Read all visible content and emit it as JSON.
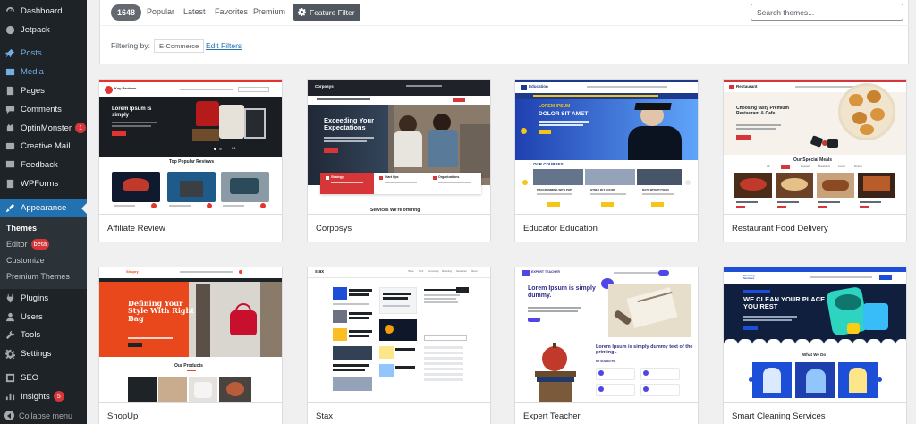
{
  "sidebar": {
    "items": [
      {
        "label": "Dashboard",
        "icon": "dashboard-icon"
      },
      {
        "label": "Jetpack",
        "icon": "jetpack-icon"
      },
      {
        "label": "Posts",
        "icon": "pin-icon"
      },
      {
        "label": "Media",
        "icon": "media-icon"
      },
      {
        "label": "Pages",
        "icon": "pages-icon"
      },
      {
        "label": "Comments",
        "icon": "comments-icon"
      },
      {
        "label": "OptinMonster",
        "icon": "optinmonster-icon",
        "badge": "1"
      },
      {
        "label": "Creative Mail",
        "icon": "creative-mail-icon"
      },
      {
        "label": "Feedback",
        "icon": "feedback-icon"
      },
      {
        "label": "WPForms",
        "icon": "wpforms-icon"
      },
      {
        "label": "Appearance",
        "icon": "appearance-icon"
      },
      {
        "label": "Plugins",
        "icon": "plugins-icon"
      },
      {
        "label": "Users",
        "icon": "users-icon"
      },
      {
        "label": "Tools",
        "icon": "tools-icon"
      },
      {
        "label": "Settings",
        "icon": "settings-icon"
      },
      {
        "label": "SEO",
        "icon": "seo-icon"
      },
      {
        "label": "Insights",
        "icon": "insights-icon",
        "badge": "5"
      }
    ],
    "appearance_submenu": [
      {
        "label": "Themes",
        "active": true
      },
      {
        "label": "Editor",
        "badge": "beta"
      },
      {
        "label": "Customize"
      },
      {
        "label": "Premium Themes"
      }
    ],
    "collapse_label": "Collapse menu"
  },
  "filter": {
    "count": "1648",
    "tabs": [
      "Popular",
      "Latest",
      "Favorites",
      "Premium"
    ],
    "feature_filter_label": "Feature Filter",
    "search_placeholder": "Search themes...",
    "filtering_by_label": "Filtering by:",
    "active_tag": "E-Commerce",
    "edit_filters_label": "Edit Filters"
  },
  "themes": [
    {
      "name": "Affiliate Review"
    },
    {
      "name": "Corposys"
    },
    {
      "name": "Educator Education"
    },
    {
      "name": "Restaurant Food Delivery"
    },
    {
      "name": "ShopUp"
    },
    {
      "name": "Stax"
    },
    {
      "name": "Expert Teacher"
    },
    {
      "name": "Smart Cleaning Services"
    }
  ],
  "previews": {
    "affiliate": {
      "logo": "Key Reviews",
      "hero": "Lorem Ipsum is simply",
      "section": "Top Popular Reviews",
      "counter": "01"
    },
    "corposys": {
      "logo": "Corposys",
      "hero": "Exceeding Your Expectations",
      "cards": [
        "Strategy",
        "Start Ups",
        "Organizations"
      ],
      "section": "Services We're offering"
    },
    "educator": {
      "logo": "Education",
      "hero_small": "LOREM IPSUM",
      "hero": "DOLOR SIT AMET",
      "section": "OUR COURSES",
      "courses": [
        "PROGRAMMING WITH PHP",
        "HTML5 IN 5 HOURS",
        "DATA WITH PYTHON"
      ]
    },
    "restaurant": {
      "logo": "Restaurant",
      "hero": "Choosing tasty Premium Restaurant & Cafe",
      "section": "Our Special Meals",
      "filters": [
        "All",
        "Lunch",
        "Dessert",
        "Breakfast",
        "Lunch",
        "Dinner"
      ]
    },
    "shopup": {
      "logo": "Shopry",
      "hero": "Defining Your Style With Right Bag",
      "section": "Our Products"
    },
    "stax": {
      "logo": "stax",
      "nav": [
        "Home",
        "Tech",
        "Community",
        "Marketing",
        "Newsletter",
        "About"
      ]
    },
    "teacher": {
      "logo": "EXPERT TEACHER",
      "hero": "Lorem Ipsum is simply dummy.",
      "subhero": "Lorem Ipsum is simply dummy text of the printing .",
      "subjects_label": "MY SUBJECTS"
    },
    "cleaning": {
      "logo": "Cleaning Services",
      "hero": "WE CLEAN YOUR PLACE YOU REST",
      "section": "What We Do"
    }
  }
}
